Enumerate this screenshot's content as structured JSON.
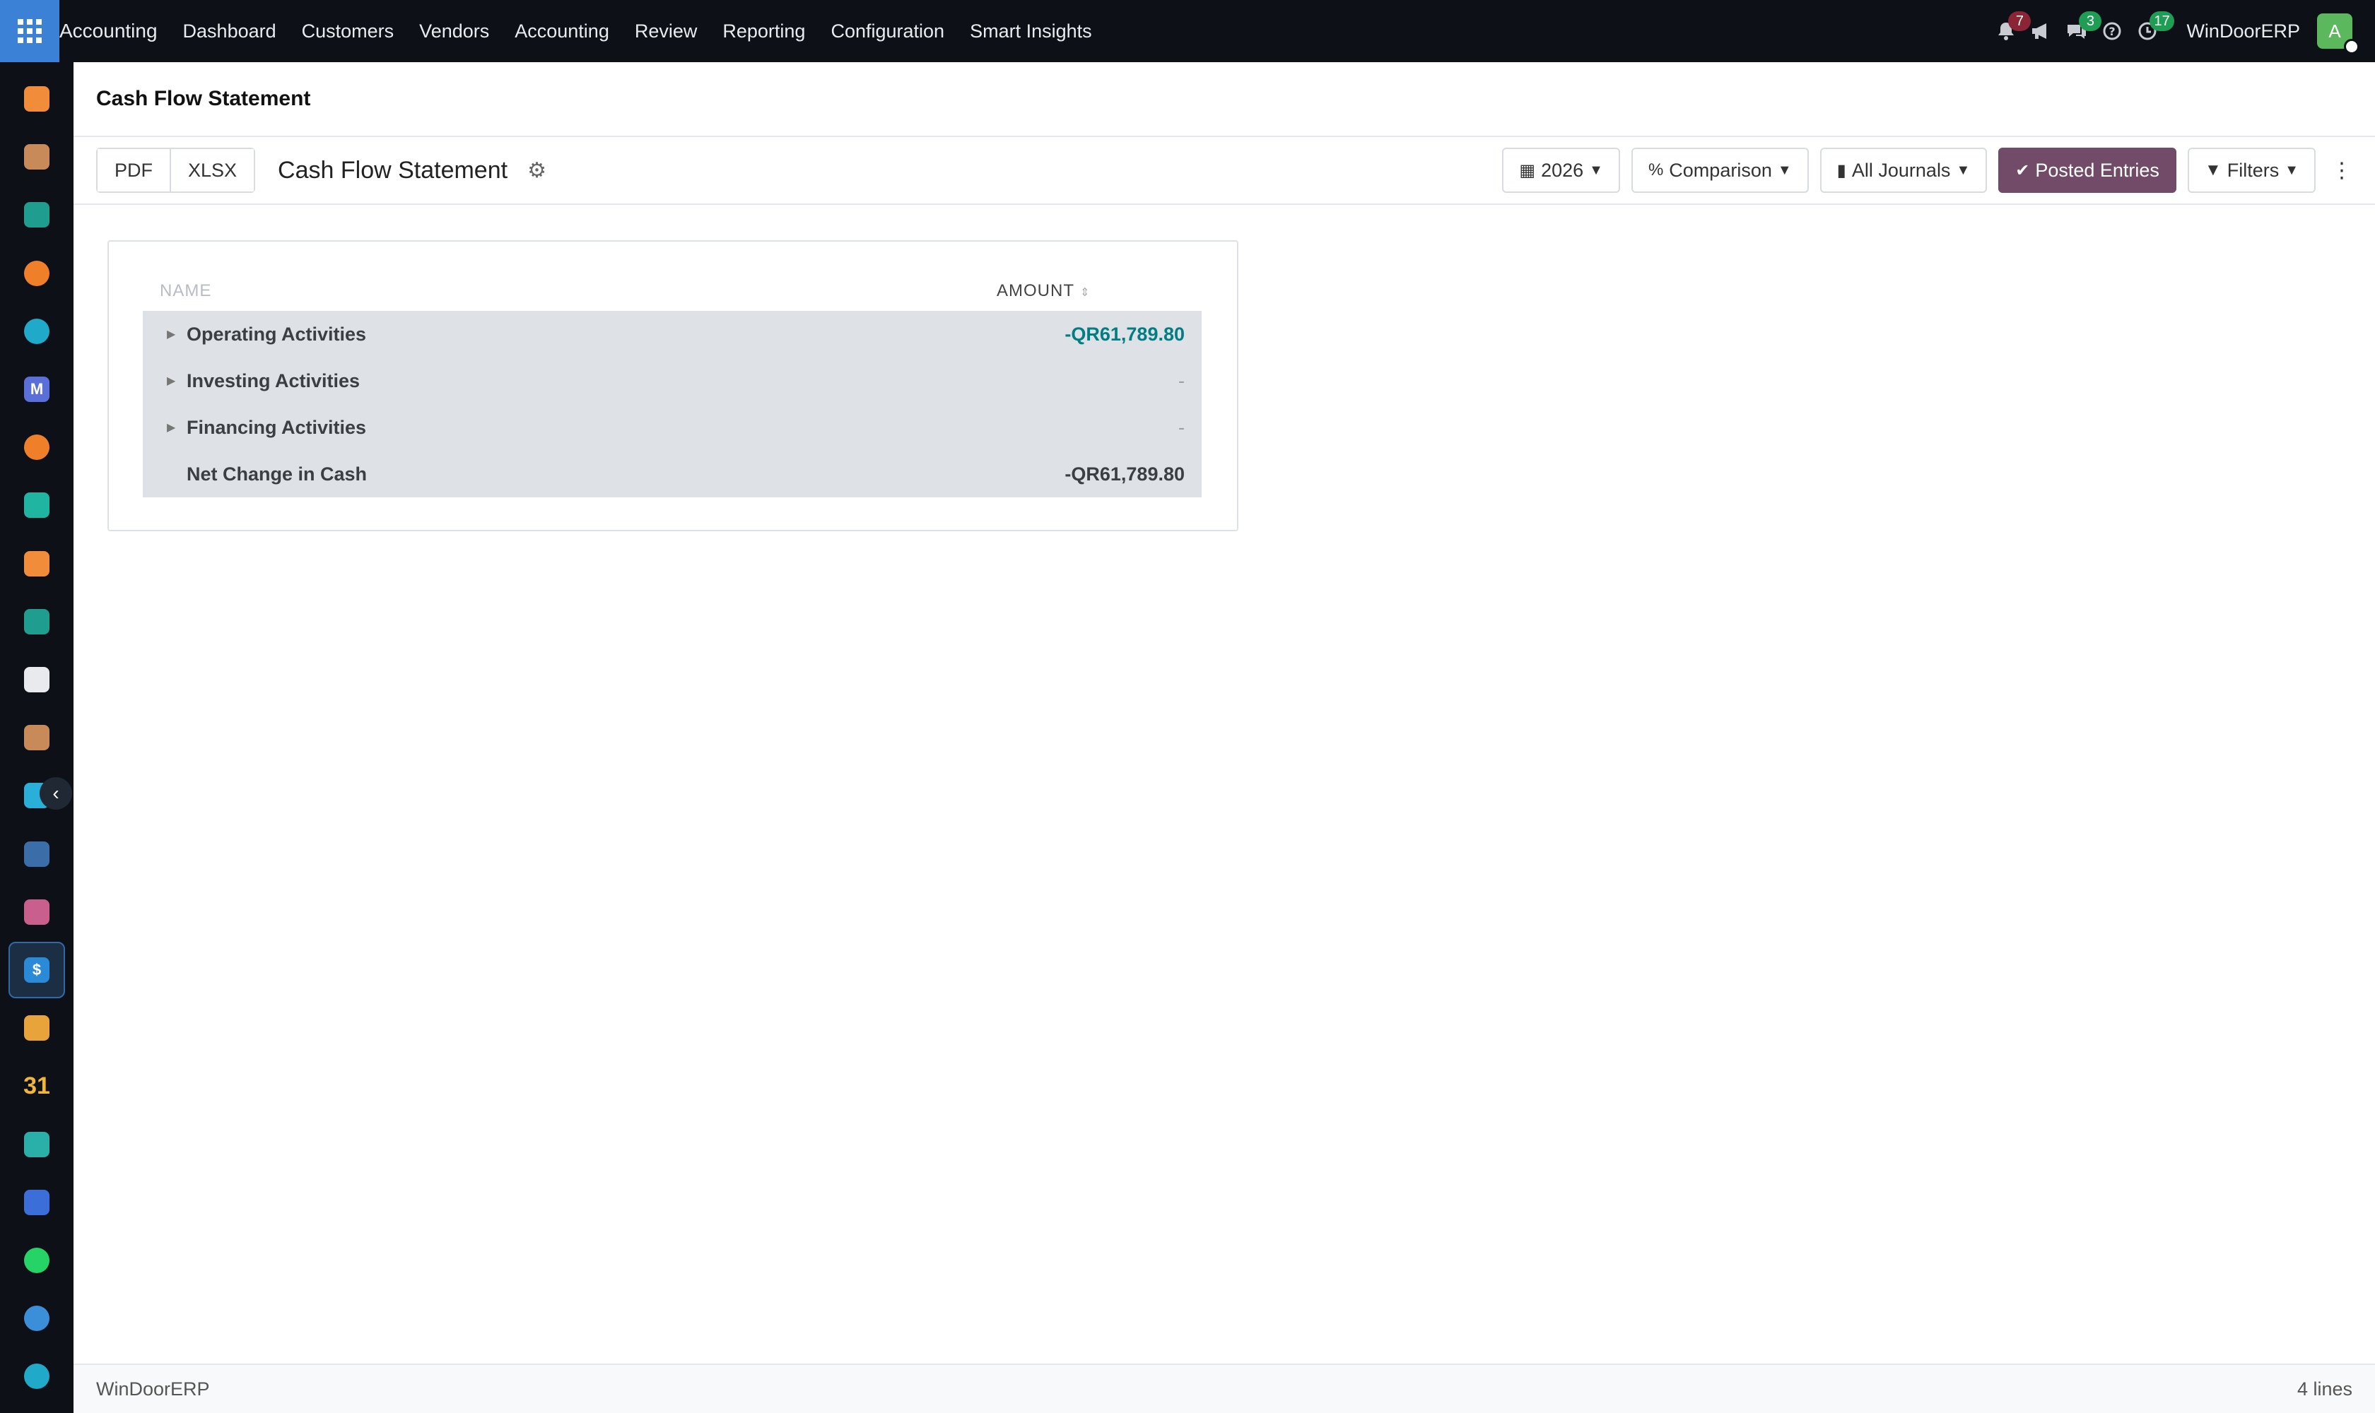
{
  "navbar": {
    "brand": "Accounting",
    "menu": [
      "Dashboard",
      "Customers",
      "Vendors",
      "Accounting",
      "Review",
      "Reporting",
      "Configuration",
      "Smart Insights"
    ],
    "notifications_count": "7",
    "messages_count": "3",
    "activities_count": "17",
    "company": "WinDoorERP",
    "avatar_initial": "A"
  },
  "sidebar": {
    "apps": [
      {
        "icon": "chart-bars-icon",
        "color": "#f08c3a"
      },
      {
        "icon": "sign-icon",
        "color": "#c98a5a"
      },
      {
        "icon": "contacts-icon",
        "color": "#1f9d8e"
      },
      {
        "icon": "chat-bubble-icon",
        "color": "#f07f2a"
      },
      {
        "icon": "wave-icon",
        "color": "#20a9c8"
      },
      {
        "icon": "mail-m-icon",
        "color": "#5a6fd8"
      },
      {
        "icon": "chat-bubble-icon",
        "color": "#f07f2a"
      },
      {
        "icon": "check-arrow-icon",
        "color": "#1fb5a0"
      },
      {
        "icon": "chart-bars-icon",
        "color": "#f08c3a"
      },
      {
        "icon": "contacts-icon",
        "color": "#1f9d8e"
      },
      {
        "icon": "cube-icon",
        "color": "#e8eaed"
      },
      {
        "icon": "sign-icon",
        "color": "#c98a5a"
      },
      {
        "icon": "check-icon",
        "color": "#2ab0d8"
      },
      {
        "icon": "book-icon",
        "color": "#3b6ea8"
      },
      {
        "icon": "box-icon",
        "color": "#c95f8c"
      },
      {
        "icon": "invoice-icon",
        "color": "#2a8ad8"
      },
      {
        "icon": "team-icon",
        "color": "#e8a33a"
      },
      {
        "icon": "calendar-31-icon",
        "color": "#f0b63a"
      },
      {
        "icon": "pen-icon",
        "color": "#2ab0a8"
      },
      {
        "icon": "dashboard-icon",
        "color": "#3b6ed8"
      },
      {
        "icon": "whatsapp-icon",
        "color": "#25d366"
      },
      {
        "icon": "gauge-icon",
        "color": "#3b8ed8"
      },
      {
        "icon": "wave-icon",
        "color": "#20a9c8"
      }
    ],
    "active_index": 15
  },
  "breadcrumb": {
    "title": "Cash Flow Statement"
  },
  "controls": {
    "pdf_label": "PDF",
    "xlsx_label": "XLSX",
    "report_title": "Cash Flow Statement",
    "date_filter": "2026",
    "comparison": "Comparison",
    "journals": "All Journals",
    "posted": "Posted Entries",
    "filters": "Filters"
  },
  "report": {
    "col_name": "NAME",
    "col_amount": "AMOUNT",
    "rows": [
      {
        "name": "Operating Activities",
        "amount": "-QR61,789.80",
        "expandable": true,
        "style": "teal"
      },
      {
        "name": "Investing Activities",
        "amount": "-",
        "expandable": true,
        "style": "dash"
      },
      {
        "name": "Financing Activities",
        "amount": "-",
        "expandable": true,
        "style": "dash"
      },
      {
        "name": "Net Change in Cash",
        "amount": "-QR61,789.80",
        "expandable": false,
        "style": "normal"
      }
    ]
  },
  "footer": {
    "company": "WinDoorERP",
    "lines": "4 lines"
  }
}
